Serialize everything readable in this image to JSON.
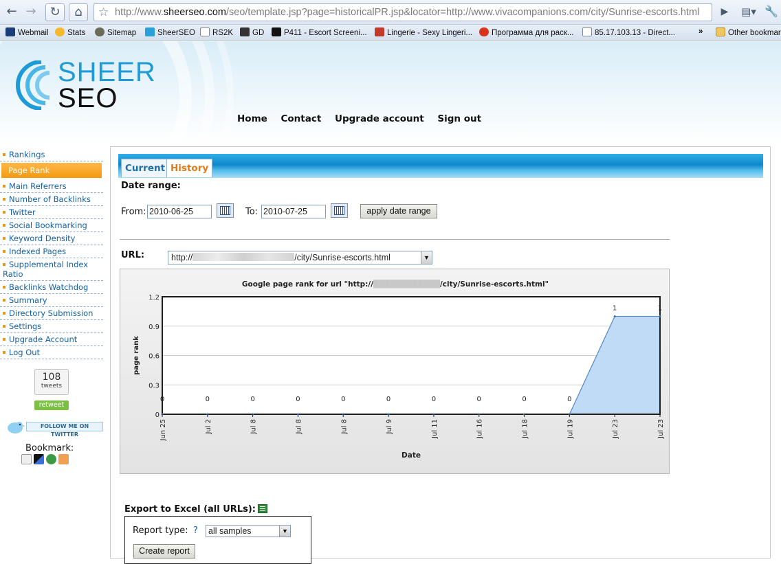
{
  "browser": {
    "url_prefix": "http://www.",
    "url_host": "sheerseo.com",
    "url_rest": "/seo/template.jsp?page=historicalPR.jsp&locator=http://www.vivacompanions.com/city/Sunrise-escorts.html",
    "bookmarks": [
      "Webmail",
      "Stats",
      "Sitemap",
      "SheerSEO",
      "RS2K",
      "GD",
      "P411 - Escort Screeni...",
      "Lingerie - Sexy Lingeri...",
      "Программа для раск...",
      "85.17.103.13 - Direct...",
      "Other bookmarks"
    ]
  },
  "logo": {
    "line1": "SHEER",
    "line2": "SEO"
  },
  "nav": {
    "home": "Home",
    "contact": "Contact",
    "upgrade": "Upgrade account",
    "signout": "Sign out"
  },
  "sidebar": {
    "items": [
      "Rankings",
      "Page Rank",
      "Main Referrers",
      "Number of Backlinks",
      "Twitter",
      "Social Bookmarking",
      "Keyword Density",
      "Indexed Pages",
      "Supplemental Index Ratio",
      "Backlinks Watchdog",
      "Summary",
      "Directory Submission",
      "Settings",
      "Upgrade Account",
      "Log Out"
    ],
    "active_index": 1,
    "tweet_count": "108",
    "tweet_label": "tweets",
    "retweet": "retweet",
    "follow": "FOLLOW ME ON TWITTER",
    "bookmark_label": "Bookmark:"
  },
  "tabs": {
    "current": "Current",
    "history": "History"
  },
  "date_range": {
    "heading": "Date range:",
    "from_label": "From:",
    "from_value": "2010-06-25",
    "to_label": "To:",
    "to_value": "2010-07-25",
    "apply_button": "apply date range"
  },
  "url_select": {
    "label": "URL:",
    "prefix": "http://",
    "suffix": "/city/Sunrise-escorts.html"
  },
  "chart_data": {
    "type": "area",
    "title_prefix": "Google page rank for url \"http://",
    "title_suffix": "/city/Sunrise-escorts.html\"",
    "xlabel": "Date",
    "ylabel": "page rank",
    "ylim": [
      0,
      1.2
    ],
    "yticks": [
      "0",
      "0.3",
      "0.6",
      "0.9",
      "1.2"
    ],
    "categories": [
      "Jun 25",
      "Jul 2",
      "Jul 8",
      "Jul 8",
      "Jul 8",
      "Jul 9",
      "Jul 11",
      "Jul 16",
      "Jul 18",
      "Jul 19",
      "Jul 23",
      "Jul 23"
    ],
    "values": [
      0,
      0,
      0,
      0,
      0,
      0,
      0,
      0,
      0,
      0,
      1,
      1
    ],
    "labels": [
      "0",
      "0",
      "0",
      "0",
      "0",
      "0",
      "0",
      "0",
      "0",
      "0",
      "1",
      "1"
    ],
    "grid": true,
    "fill_color": "#bcd9f4",
    "line_color": "#1c1c1c"
  },
  "export": {
    "label": "Export to Excel (all URLs):",
    "report_type_label": "Report type:",
    "help": "?",
    "report_type_value": "all samples",
    "create_button": "Create report"
  }
}
